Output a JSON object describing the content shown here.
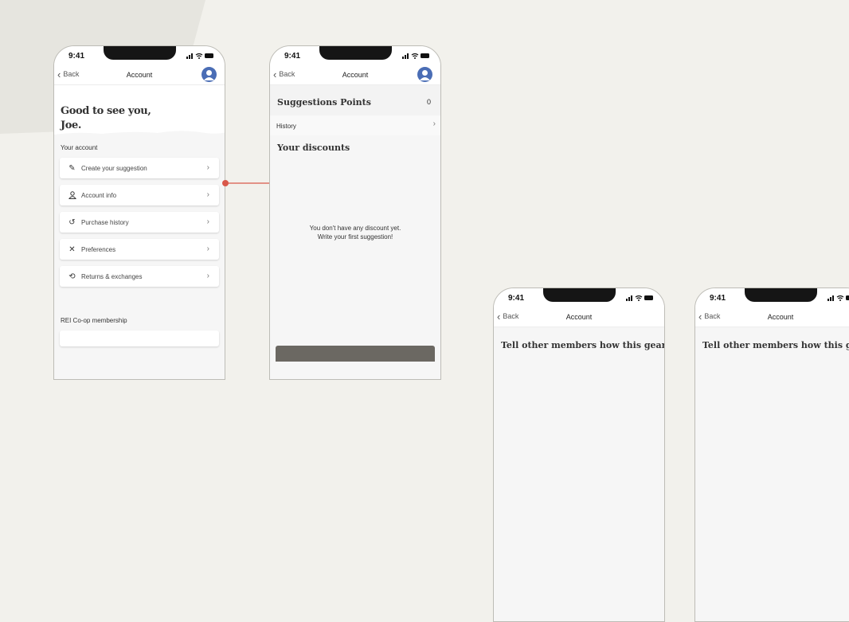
{
  "status_time": "9:41",
  "nav": {
    "back": "Back",
    "title": "Account"
  },
  "screen1": {
    "greeting_line1": "Good to see you,",
    "greeting_line2": "Joe.",
    "section_account": "Your account",
    "items": [
      {
        "label": "Create your suggestion",
        "icon": "pencil-icon"
      },
      {
        "label": "Account info",
        "icon": "person-icon"
      },
      {
        "label": "Purchase history",
        "icon": "history-icon"
      },
      {
        "label": "Preferences",
        "icon": "tools-icon"
      },
      {
        "label": "Returns & exchanges",
        "icon": "returns-icon"
      }
    ],
    "section_membership": "REI Co-op membership"
  },
  "screen2": {
    "points_title": "Suggestions Points",
    "points_value": "0",
    "history": "History",
    "discounts_title": "Your discounts",
    "empty_line1": "You don't have any discount yet.",
    "empty_line2": "Write your first suggestion!"
  },
  "screen3": {
    "heading": "Tell other members how this gear was"
  },
  "screen4": {
    "heading": "Tell other members how this gear was"
  },
  "colors": {
    "accent": "#d9584a",
    "avatar": "#4a6db5"
  }
}
